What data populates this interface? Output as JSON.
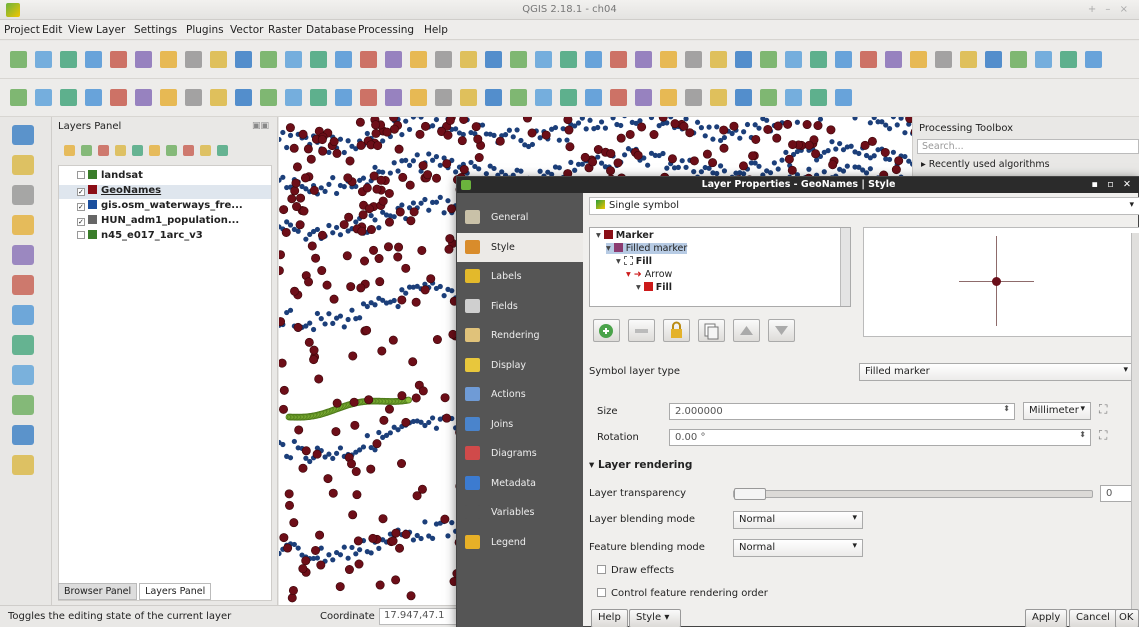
{
  "window": {
    "title": "QGIS 2.18.1 - ch04",
    "controls": "+ – ×"
  },
  "menu": [
    "Project",
    "Edit",
    "View",
    "Layer",
    "Settings",
    "Plugins",
    "Vector",
    "Raster",
    "Database",
    "Processing",
    "Help"
  ],
  "layers_panel": {
    "title": "Layers Panel",
    "layers": [
      {
        "name": "landsat",
        "checked": false,
        "color": "#3a7d2a"
      },
      {
        "name": "GeoNames",
        "checked": true,
        "color": "#8b0e16",
        "selected": true
      },
      {
        "name": "gis.osm_waterways_fre...",
        "checked": true,
        "color": "#1b4f9e"
      },
      {
        "name": "HUN_adm1_population...",
        "checked": true,
        "color": "#666666"
      },
      {
        "name": "n45_e017_1arc_v3",
        "checked": false,
        "color": "#3a7d2a"
      }
    ],
    "tabs": [
      "Browser Panel",
      "Layers Panel"
    ]
  },
  "processing": {
    "title": "Processing Toolbox",
    "search_placeholder": "Search...",
    "recent": "Recently used algorithms"
  },
  "statusbar": {
    "message": "Toggles the editing state of the current layer",
    "coord_label": "Coordinate",
    "coord_value": "17.947,47.1"
  },
  "dialog": {
    "title": "Layer Properties - GeoNames | Style",
    "nav": [
      {
        "label": "General",
        "icon": "wrench-icon",
        "color": "#c9c1a8"
      },
      {
        "label": "Style",
        "icon": "paint-brush-icon",
        "color": "#d98c2b",
        "active": true
      },
      {
        "label": "Labels",
        "icon": "label-icon",
        "color": "#e3b92b"
      },
      {
        "label": "Fields",
        "icon": "table-icon",
        "color": "#cfcfcf"
      },
      {
        "label": "Rendering",
        "icon": "brush-icon",
        "color": "#e0c27a"
      },
      {
        "label": "Display",
        "icon": "speech-bubble-icon",
        "color": "#e8c73c"
      },
      {
        "label": "Actions",
        "icon": "gear-icon",
        "color": "#6f9bd6"
      },
      {
        "label": "Joins",
        "icon": "join-icon",
        "color": "#4a84cc"
      },
      {
        "label": "Diagrams",
        "icon": "chart-icon",
        "color": "#d04a4a"
      },
      {
        "label": "Metadata",
        "icon": "info-icon",
        "color": "#3c7bd0"
      },
      {
        "label": "Variables",
        "icon": "variables-icon",
        "color": "#555555"
      },
      {
        "label": "Legend",
        "icon": "legend-icon",
        "color": "#e7b027"
      }
    ],
    "symbol_mode": "Single symbol",
    "symbol_tree": [
      {
        "label": "Marker",
        "indent": 0,
        "color": "#8b0e16",
        "bold": true
      },
      {
        "label": "Filled marker",
        "indent": 1,
        "color": "#8b3b70",
        "selected": true
      },
      {
        "label": "Fill",
        "indent": 2,
        "color": "#ffffff",
        "bold": true
      },
      {
        "label": "Arrow",
        "indent": 3,
        "color": "#cc1a1a"
      },
      {
        "label": "Fill",
        "indent": 4,
        "color": "#cc1a1a",
        "bold": true
      }
    ],
    "symbol_layer_type_label": "Symbol layer type",
    "symbol_layer_type": "Filled marker",
    "size_label": "Size",
    "size_value": "2.000000",
    "size_unit": "Millimeter",
    "rotation_label": "Rotation",
    "rotation_value": "0.00 °",
    "layer_rendering": {
      "title": "Layer rendering",
      "transparency_label": "Layer transparency",
      "transparency_value": "0",
      "layer_blending_label": "Layer blending mode",
      "layer_blending_value": "Normal",
      "feature_blending_label": "Feature blending mode",
      "feature_blending_value": "Normal",
      "draw_effects": "Draw effects",
      "control_order": "Control feature rendering order"
    },
    "buttons": {
      "help": "Help",
      "style": "Style",
      "apply": "Apply",
      "cancel": "Cancel",
      "ok": "OK"
    }
  }
}
